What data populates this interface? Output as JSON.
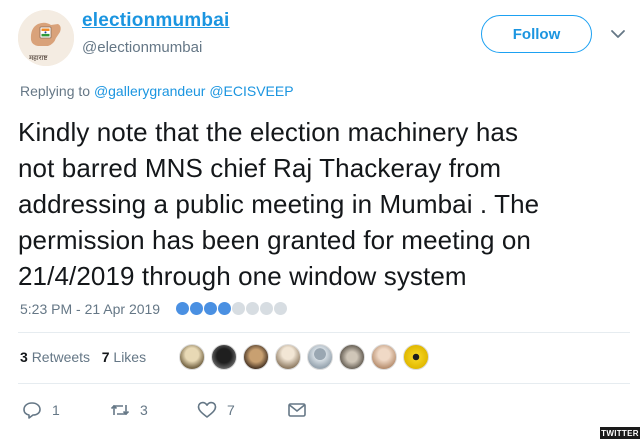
{
  "user": {
    "display_name": "electionmumbai",
    "handle": "@electionmumbai",
    "avatar_icon": "election-emblem-icon",
    "avatar_text": "महाराष्ट"
  },
  "follow_button": {
    "label": "Follow"
  },
  "reply": {
    "prefix": "Replying to",
    "mentions": [
      "@gallerygrandeur",
      "@ECISVEEP"
    ]
  },
  "tweet": {
    "lines": [
      "Kindly note that the election machinery has",
      "not barred MNS chief Raj Thackeray from",
      "addressing a public meeting in Mumbai . The",
      "permission has been granted for meeting on",
      "21/4/2019 through one window system"
    ],
    "timestamp": "5:23 PM - 21 Apr 2019"
  },
  "stats": {
    "retweets_count": "3",
    "retweets_label": "Retweets",
    "likes_count": "7",
    "likes_label": "Likes"
  },
  "actions": {
    "reply_count": "1",
    "retweet_count": "3",
    "like_count": "7"
  },
  "colors": {
    "accent": "#1da1f2",
    "link": "#1b95e0",
    "muted": "#657786",
    "text": "#14171a"
  },
  "watermark": {
    "text": "TWITTER"
  }
}
